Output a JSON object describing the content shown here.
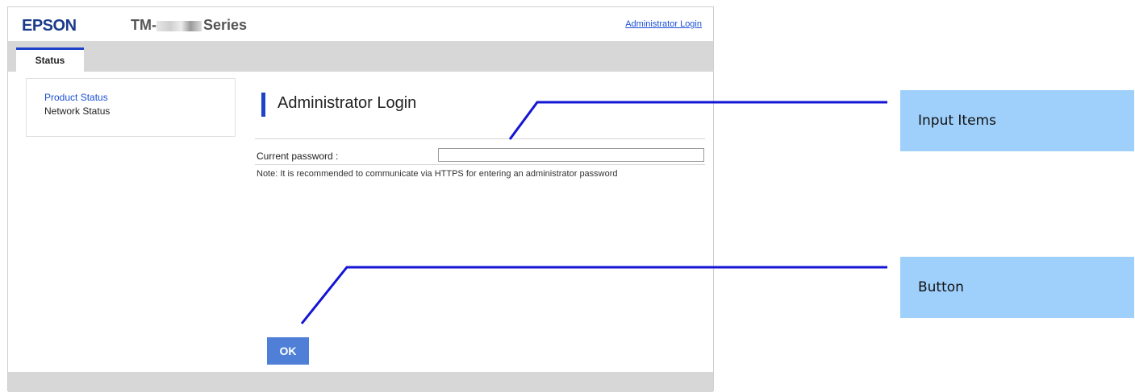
{
  "header": {
    "brand": "EPSON",
    "model_prefix": "TM-",
    "model_suffix": "Series",
    "admin_link": "Administrator Login"
  },
  "tabs": [
    {
      "label": "Status"
    }
  ],
  "sidebar": {
    "items": [
      {
        "label": "Product Status"
      },
      {
        "label": "Network Status"
      }
    ]
  },
  "main": {
    "title": "Administrator Login",
    "password_label": "Current password :",
    "password_value": "",
    "note": "Note: It is recommended to communicate via HTTPS for entering an administrator password",
    "ok_label": "OK"
  },
  "callouts": {
    "input_items": "Input Items",
    "button": "Button"
  },
  "colors": {
    "brand": "#1b3b8a",
    "accent": "#1f43c8",
    "link": "#1a4fd6",
    "button": "#4f7fd6",
    "callout": "#9fd0fb"
  }
}
